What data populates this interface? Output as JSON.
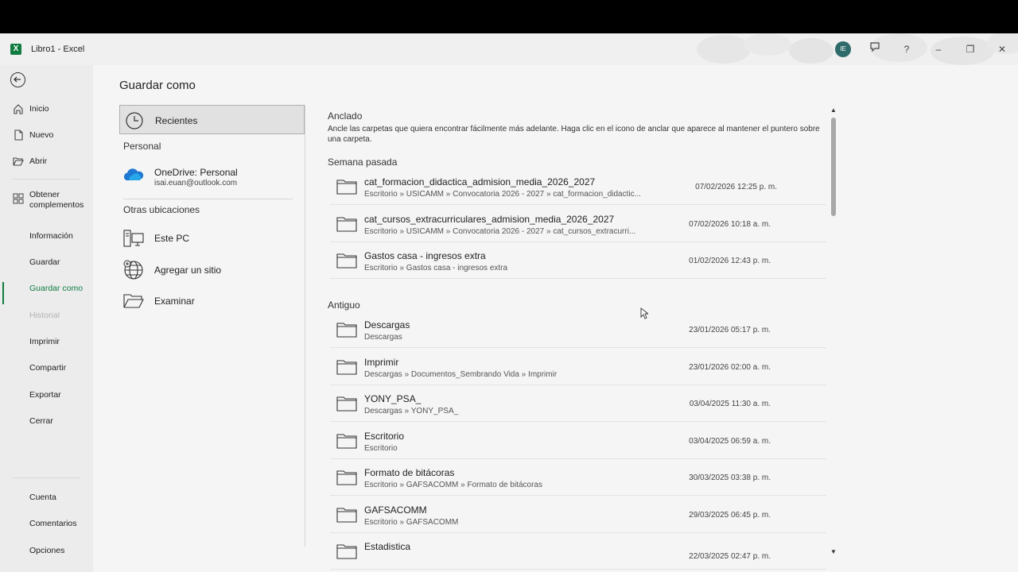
{
  "window": {
    "title": "Libro1  -  Excel",
    "app_icon": "excel-icon",
    "avatar_initials": "IE",
    "controls": [
      "minimize",
      "restore",
      "close"
    ]
  },
  "nav": {
    "back": "back-arrow-icon",
    "items": [
      {
        "label": "Inicio",
        "icon": "home-icon"
      },
      {
        "label": "Nuevo",
        "icon": "new-document-icon"
      },
      {
        "label": "Abrir",
        "icon": "open-folder-icon"
      },
      {
        "label": "Obtener\ncomplementos",
        "icon": "addins-grid-icon"
      },
      {
        "label": "Información"
      },
      {
        "label": "Guardar"
      },
      {
        "label": "Guardar como",
        "selected": true
      },
      {
        "label": "Historial",
        "disabled": true
      },
      {
        "label": "Imprimir"
      },
      {
        "label": "Compartir"
      },
      {
        "label": "Exportar"
      },
      {
        "label": "Cerrar"
      }
    ],
    "bottom_items": [
      {
        "label": "Cuenta"
      },
      {
        "label": "Comentarios"
      },
      {
        "label": "Opciones"
      }
    ]
  },
  "page": {
    "title": "Guardar como"
  },
  "locations": {
    "recent": "Recientes",
    "personal_header": "Personal",
    "onedrive_label": "OneDrive: Personal",
    "onedrive_account": "isai.euan@outlook.com",
    "other_header": "Otras ubicaciones",
    "this_pc": "Este PC",
    "add_site": "Agregar un sitio",
    "browse": "Examinar"
  },
  "files": {
    "pinned_header": "Anclado",
    "pinned_desc": "Ancle las carpetas que quiera encontrar fácilmente más adelante. Haga clic en el icono de anclar que aparece al mantener el puntero sobre una carpeta.",
    "last_week_header": "Semana pasada",
    "last_week": [
      {
        "name": "cat_formacion_didactica_admision_media_2026_2027",
        "path": "Escritorio » USICAMM » Convocatoria 2026 - 2027 » cat_formacion_didactic...",
        "date": "07/02/2026 12:25 p. m."
      },
      {
        "name": "cat_cursos_extracurriculares_admision_media_2026_2027",
        "path": "Escritorio » USICAMM » Convocatoria 2026 - 2027 » cat_cursos_extracurri...",
        "date": "07/02/2026 10:18 a. m."
      },
      {
        "name": "Gastos casa - ingresos extra",
        "path": "Escritorio » Gastos casa - ingresos extra",
        "date": "01/02/2026 12:43 p. m."
      }
    ],
    "older_header": "Antiguo",
    "older": [
      {
        "name": "Descargas",
        "path": "Descargas",
        "date": "23/01/2026 05:17 p. m."
      },
      {
        "name": "Imprimir",
        "path": "Descargas » Documentos_Sembrando Vida » Imprimir",
        "date": "23/01/2026 02:00 a. m."
      },
      {
        "name": "YONY_PSA_",
        "path": "Descargas » YONY_PSA_",
        "date": "03/04/2025 11:30 a. m."
      },
      {
        "name": "Escritorio",
        "path": "Escritorio",
        "date": "03/04/2025 06:59 a. m."
      },
      {
        "name": "Formato de bitácoras",
        "path": "Escritorio » GAFSACOMM » Formato de bitácoras",
        "date": "30/03/2025 03:38 p. m."
      },
      {
        "name": "GAFSACOMM",
        "path": "Escritorio » GAFSACOMM",
        "date": "29/03/2025 06:45 p. m."
      },
      {
        "name": "Estadistica",
        "path": "",
        "date": "22/03/2025 02:47 p. m."
      }
    ]
  },
  "colors": {
    "accent": "#107c41",
    "background": "#f5f5f5",
    "nav_background": "#ececec"
  }
}
